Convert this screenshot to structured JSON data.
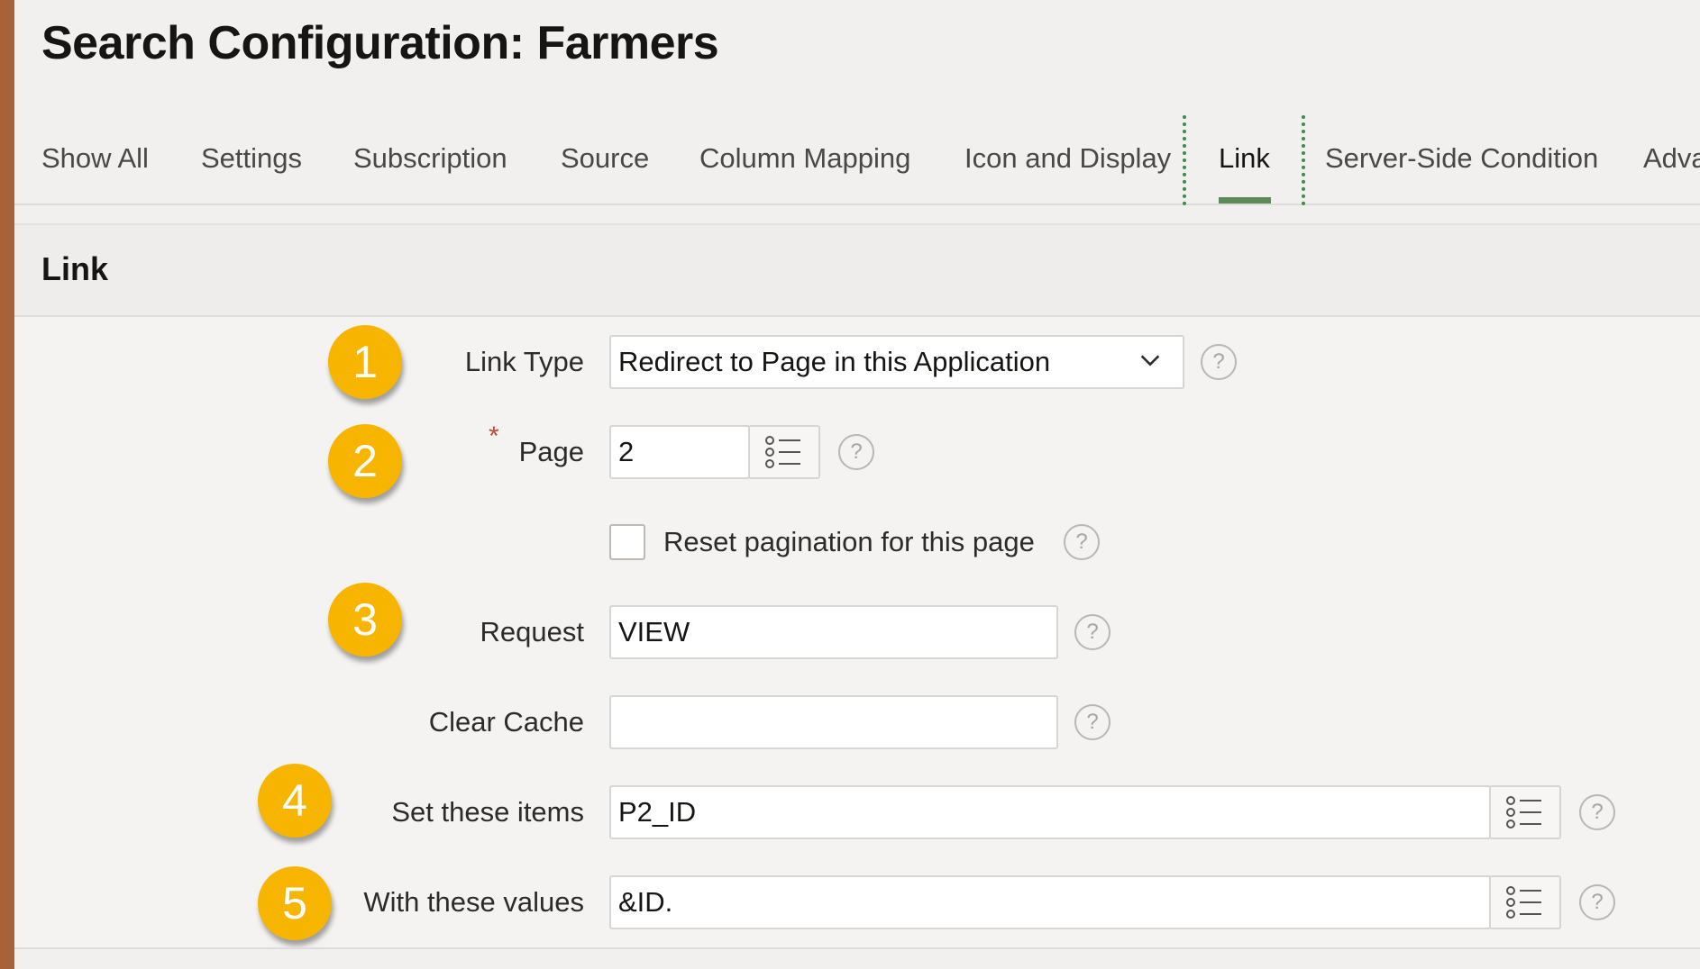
{
  "page_title": "Search Configuration: Farmers",
  "tabs": [
    {
      "label": "Show All"
    },
    {
      "label": "Settings"
    },
    {
      "label": "Subscription"
    },
    {
      "label": "Source"
    },
    {
      "label": "Column Mapping"
    },
    {
      "label": "Icon and Display"
    },
    {
      "label": "Link"
    },
    {
      "label": "Server-Side Condition"
    },
    {
      "label": "Adva"
    }
  ],
  "active_tab": "Link",
  "section": {
    "title": "Link"
  },
  "fields": {
    "link_type": {
      "label": "Link Type",
      "value": "Redirect to Page in this Application"
    },
    "page": {
      "label": "Page",
      "required_marker": "*",
      "value": "2"
    },
    "reset_pagination": {
      "label": "Reset pagination for this page",
      "checked": false
    },
    "request": {
      "label": "Request",
      "value": "VIEW"
    },
    "clear_cache": {
      "label": "Clear Cache",
      "value": ""
    },
    "set_items": {
      "label": "Set these items",
      "value": "P2_ID"
    },
    "with_values": {
      "label": "With these values",
      "value": "&ID."
    }
  },
  "help_glyph": "?",
  "badges": [
    "1",
    "2",
    "3",
    "4",
    "5"
  ],
  "colors": {
    "accent_underline": "#5d8a56",
    "badge": "#f7b500",
    "required": "#c74634",
    "dotted_focus": "#3c8a4e"
  }
}
